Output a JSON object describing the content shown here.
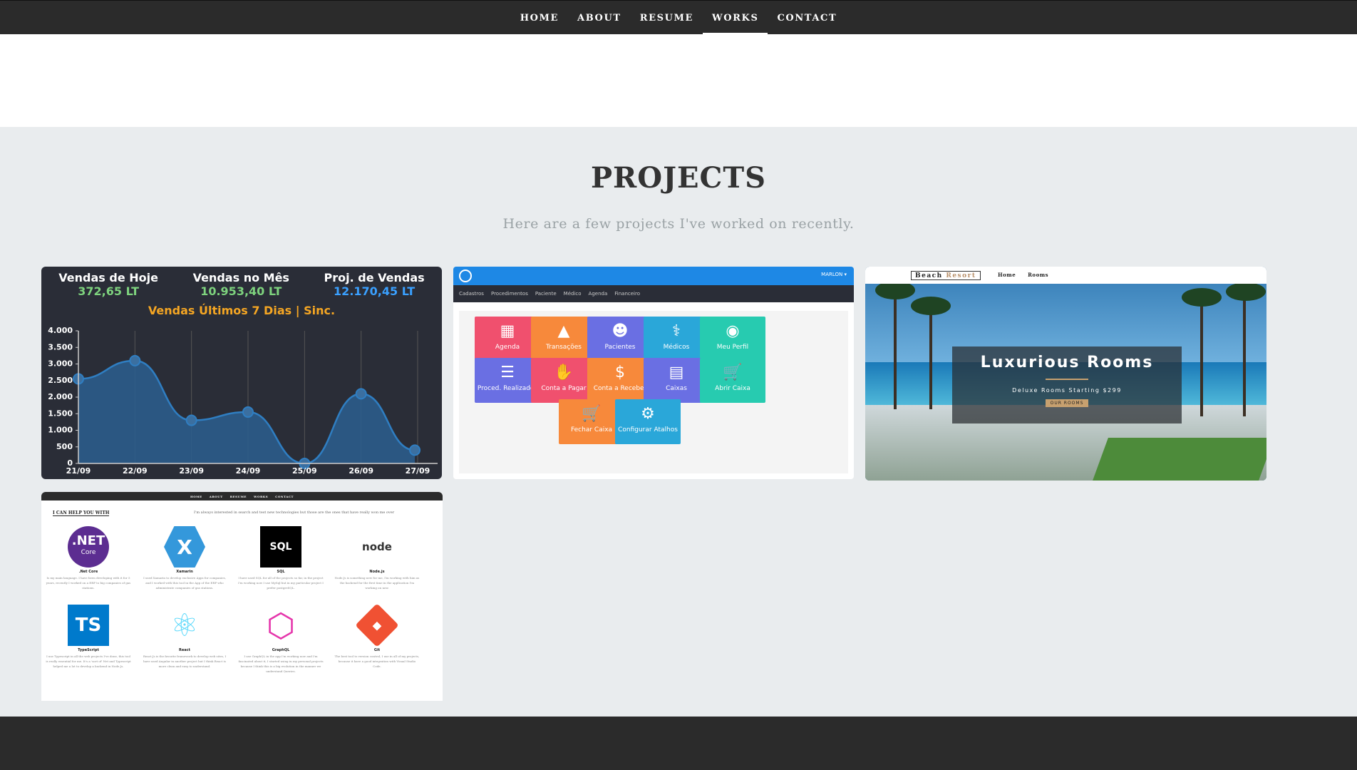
{
  "nav": {
    "items": [
      {
        "label": "HOME",
        "active": false
      },
      {
        "label": "ABOUT",
        "active": false
      },
      {
        "label": "RESUME",
        "active": false
      },
      {
        "label": "WORKS",
        "active": true
      },
      {
        "label": "CONTACT",
        "active": false
      }
    ]
  },
  "projects": {
    "title": "PROJECTS",
    "subtitle": "Here are a few projects I've worked on recently."
  },
  "dashboard": {
    "stats": [
      {
        "label": "Vendas de Hoje",
        "value": "372,65 LT",
        "color": "#7ed37e"
      },
      {
        "label": "Vendas no Mês",
        "value": "10.953,40 LT",
        "color": "#7ed37e"
      },
      {
        "label": "Proj. de Vendas",
        "value": "12.170,45 LT",
        "color": "#3aa0ff"
      }
    ],
    "chart_title": "Vendas Últimos 7 Dias | Sinc."
  },
  "chart_data": {
    "type": "area",
    "title": "Vendas Últimos 7 Dias | Sinc.",
    "categories": [
      "21/09",
      "22/09",
      "23/09",
      "24/09",
      "25/09",
      "26/09",
      "27/09"
    ],
    "yticks": [
      "0",
      "500",
      "1.000",
      "1.500",
      "2.000",
      "2.500",
      "3.000",
      "3.500",
      "4.000"
    ],
    "x_values": [
      0,
      1,
      2,
      3,
      4,
      5,
      5.95
    ],
    "values": [
      2550,
      3100,
      1300,
      1550,
      0,
      2100,
      400
    ],
    "ylim": [
      0,
      4000
    ],
    "colors": {
      "line": "#2f7ec2",
      "fill": "#2b5f8f",
      "axis": "#ffffff"
    }
  },
  "admin": {
    "user": "MARLON ▾",
    "menu": [
      "Cadastros",
      "Procedimentos",
      "Paciente",
      "Médico",
      "Agenda",
      "Financeiro"
    ],
    "tiles": [
      {
        "label": "Agenda",
        "icon": "calendar-icon",
        "glyph": "▦",
        "color": "#f0506e"
      },
      {
        "label": "Transações",
        "icon": "chart-icon",
        "glyph": "▲",
        "color": "#f7893b"
      },
      {
        "label": "Pacientes",
        "icon": "users-icon",
        "glyph": "☻",
        "color": "#6a6fe3"
      },
      {
        "label": "Médicos",
        "icon": "doctor-icon",
        "glyph": "⚕",
        "color": "#2aa7d9"
      },
      {
        "label": "Meu Perfil",
        "icon": "profile-icon",
        "glyph": "◉",
        "color": "#27cbb0"
      },
      {
        "label": "Proced. Realizados",
        "icon": "clipboard-icon",
        "glyph": "☰",
        "color": "#6a6fe3"
      },
      {
        "label": "Conta a Pagar",
        "icon": "handshake-icon",
        "glyph": "✋",
        "color": "#f0506e"
      },
      {
        "label": "Conta a Receber",
        "icon": "money-icon",
        "glyph": "$",
        "color": "#f7893b"
      },
      {
        "label": "Caixas",
        "icon": "register-icon",
        "glyph": "▤",
        "color": "#6a6fe3"
      },
      {
        "label": "Abrir Caixa",
        "icon": "cart-icon",
        "glyph": "🛒",
        "color": "#27cbb0"
      },
      {
        "label": "Fechar Caixa",
        "icon": "cart-icon",
        "glyph": "🛒",
        "color": "#f7893b"
      },
      {
        "label": "Configurar Atalhos",
        "icon": "gear-icon",
        "glyph": "⚙",
        "color": "#2aa7d9"
      }
    ]
  },
  "resort": {
    "brand_1": "Beach",
    "brand_2": "Resort",
    "links": [
      "Home",
      "Rooms"
    ],
    "heading": "Luxurious Rooms",
    "sub": "Deluxe Rooms Starting $299",
    "button": "OUR ROOMS"
  },
  "skills": {
    "menu": [
      "HOME",
      "ABOUT",
      "RESUME",
      "WORKS",
      "CONTACT"
    ],
    "heading": "I CAN HELP YOU WITH",
    "intro": "I'm always interested in search and test new technologies but those are the ones that have really won me over",
    "items": [
      {
        "name": ".Net Core",
        "logo": ".NET",
        "logo_sub": "Core",
        "icon": "dotnet-icon",
        "desc": "Is my main language. I have been developing with it for 5 years, recently I worked on a ERP to big companies of gas stations."
      },
      {
        "name": "Xamarin",
        "logo": "X",
        "icon": "xamarin-icon",
        "desc": "I used Xamarin to develop exclusive Apps for companies, and I worked with this tool in the App of the ERP who administrate companies of gas stations."
      },
      {
        "name": "SQL",
        "logo": "SQL",
        "icon": "sql-icon",
        "desc": "I have used SQL for all of the projects so far, in the project I'm working now I use MySql but in my particular project I prefer postgreSQL."
      },
      {
        "name": "Node.js",
        "logo": "node",
        "icon": "nodejs-icon",
        "desc": "Node.Js is something new for me, I'm working with him as the backend for the first time in the application I'm working on now."
      },
      {
        "name": "TypeScript",
        "logo": "TS",
        "icon": "typescript-icon",
        "desc": "I use Typescript in all the web projects I've done, this tool is really essential for me. It's a 'sort of' Net and Typescript helped me a lot to develop a backend in Node.Js."
      },
      {
        "name": "React",
        "logo": "⚛",
        "icon": "react-icon",
        "desc": "React.Js is the favorite framework to develop web sites, I have used Angular in another project but I think React is more clean and easy to understand."
      },
      {
        "name": "GraphQL",
        "logo": "⬡",
        "icon": "graphql-icon",
        "desc": "I use GraphQL in the app I'm working now and I'm fascinated about it, I started using in my personal projects because I think this is a big evolution in the manner we understand Queries."
      },
      {
        "name": "Git",
        "logo": "◆",
        "icon": "git-icon",
        "desc": "The best tool to version control, I use in all of my projects, because it have a good integration with Visual Studio Code."
      }
    ]
  }
}
